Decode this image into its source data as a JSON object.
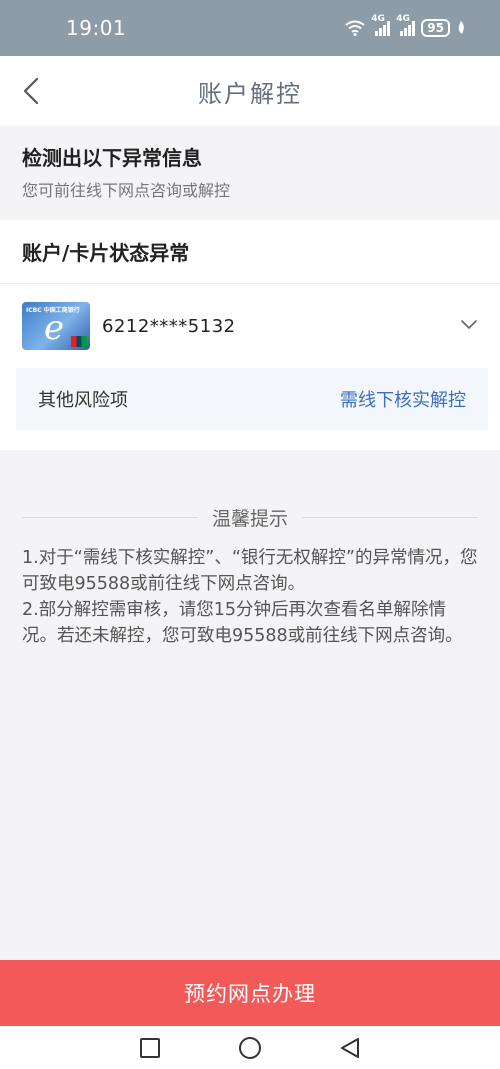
{
  "status_bar": {
    "time": "19:01",
    "network_1": "4G",
    "network_2": "4G",
    "battery": "95"
  },
  "nav": {
    "title": "账户解控"
  },
  "detect": {
    "title": "检测出以下异常信息",
    "subtitle": "您可前往线下网点咨询或解控"
  },
  "account_section": {
    "title": "账户/卡片状态异常",
    "card": {
      "bank_logo": "ICBC 中国工商银行",
      "number": "6212****5132"
    },
    "risk": {
      "label": "其他风险项",
      "action": "需线下核实解控"
    }
  },
  "tips": {
    "title": "温馨提示",
    "item_1": "1.对于“需线下核实解控”、“银行无权解控”的异常情况，您可致电95588或前往线下网点咨询。",
    "item_2": "2.部分解控需审核，请您15分钟后再次查看名单解除情况。若还未解控，您可致电95588或前往线下网点咨询。"
  },
  "book_button": "预约网点办理",
  "colors": {
    "status_bar": "#8e9ca8",
    "primary_button": "#f25a59",
    "link": "#3a6fc4"
  }
}
